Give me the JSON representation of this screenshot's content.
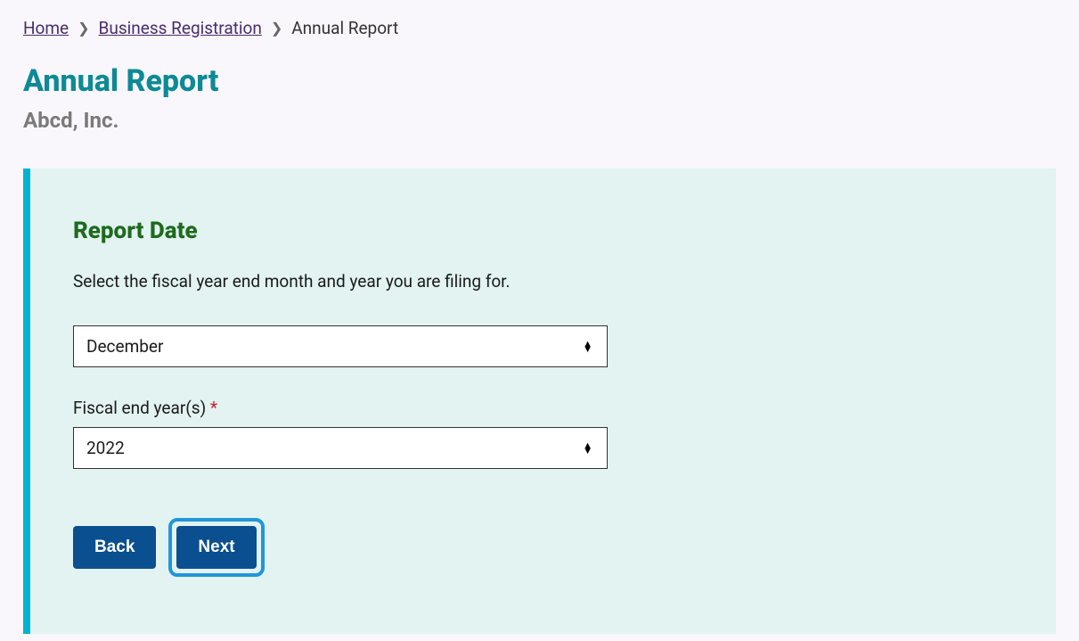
{
  "breadcrumb": {
    "home": "Home",
    "business": "Business Registration",
    "current": "Annual Report"
  },
  "page": {
    "title": "Annual Report",
    "subtitle": "Abcd, Inc."
  },
  "panel": {
    "heading": "Report Date",
    "instruction": "Select the fiscal year end month and year you are filing for.",
    "month_value": "December",
    "year_label": "Fiscal end year(s)",
    "year_value": "2022"
  },
  "buttons": {
    "back": "Back",
    "next": "Next"
  }
}
